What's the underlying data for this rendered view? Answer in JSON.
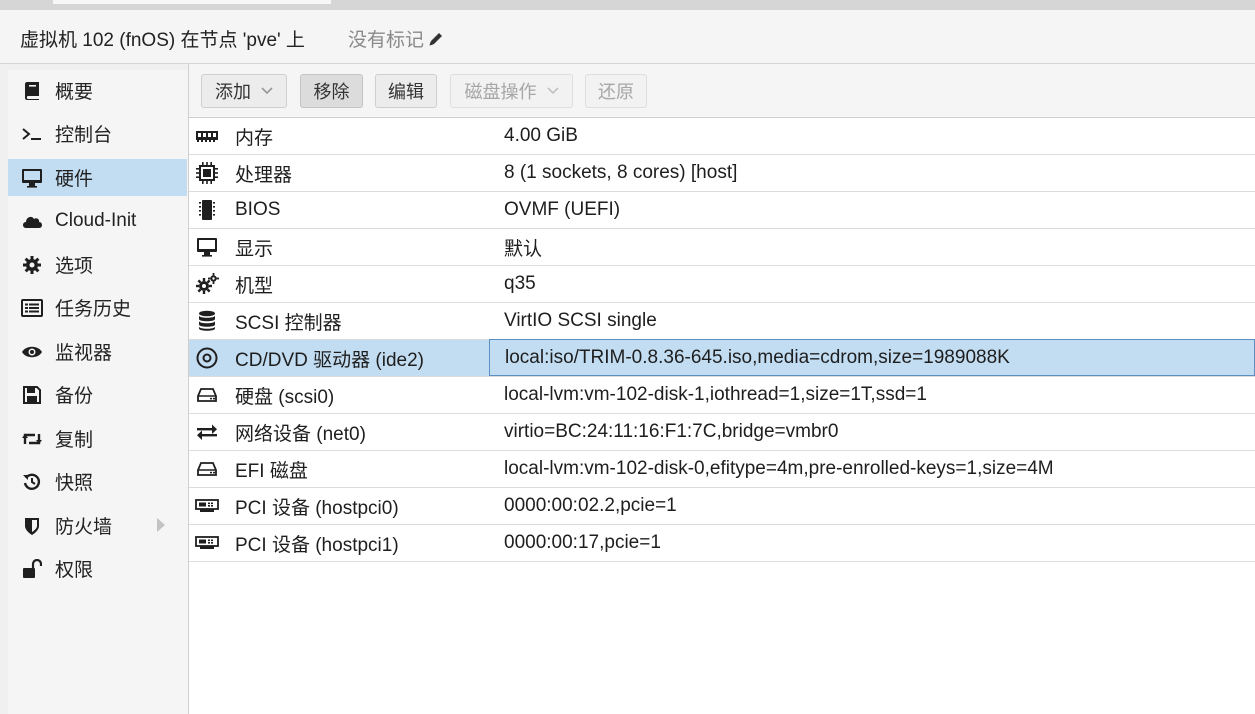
{
  "header": {
    "title": "虚拟机 102 (fnOS) 在节点 'pve' 上",
    "tags_label": "没有标记"
  },
  "sidebar": {
    "items": [
      {
        "label": "概要",
        "icon": "book-icon"
      },
      {
        "label": "控制台",
        "icon": "terminal-icon"
      },
      {
        "label": "硬件",
        "icon": "desktop-icon",
        "selected": true
      },
      {
        "label": "Cloud-Init",
        "icon": "cloud-icon"
      },
      {
        "label": "选项",
        "icon": "gear-icon"
      },
      {
        "label": "任务历史",
        "icon": "list-icon"
      },
      {
        "label": "监视器",
        "icon": "eye-icon"
      },
      {
        "label": "备份",
        "icon": "floppy-icon"
      },
      {
        "label": "复制",
        "icon": "retweet-icon"
      },
      {
        "label": "快照",
        "icon": "history-icon"
      },
      {
        "label": "防火墙",
        "icon": "shield-icon",
        "expandable": true
      },
      {
        "label": "权限",
        "icon": "unlock-icon"
      }
    ]
  },
  "toolbar": {
    "add": "添加",
    "remove": "移除",
    "edit": "编辑",
    "disk_action": "磁盘操作",
    "revert": "还原"
  },
  "hardware": [
    {
      "name": "内存",
      "value": "4.00 GiB",
      "icon": "memory-icon"
    },
    {
      "name": "处理器",
      "value": "8 (1 sockets, 8 cores) [host]",
      "icon": "cpu-icon"
    },
    {
      "name": "BIOS",
      "value": "OVMF (UEFI)",
      "icon": "microchip-icon"
    },
    {
      "name": "显示",
      "value": "默认",
      "icon": "desktop-icon"
    },
    {
      "name": "机型",
      "value": "q35",
      "icon": "cogs-icon"
    },
    {
      "name": "SCSI 控制器",
      "value": "VirtIO SCSI single",
      "icon": "database-icon"
    },
    {
      "name": "CD/DVD 驱动器 (ide2)",
      "value": "local:iso/TRIM-0.8.36-645.iso,media=cdrom,size=1989088K",
      "icon": "cdrom-icon",
      "selected": true
    },
    {
      "name": "硬盘 (scsi0)",
      "value": "local-lvm:vm-102-disk-1,iothread=1,size=1T,ssd=1",
      "icon": "hdd-icon"
    },
    {
      "name": "网络设备 (net0)",
      "value": "virtio=BC:24:11:16:F1:7C,bridge=vmbr0",
      "icon": "exchange-icon"
    },
    {
      "name": "EFI 磁盘",
      "value": "local-lvm:vm-102-disk-0,efitype=4m,pre-enrolled-keys=1,size=4M",
      "icon": "hdd-icon"
    },
    {
      "name": "PCI 设备 (hostpci0)",
      "value": "0000:00:02.2,pcie=1",
      "icon": "pci-card-icon"
    },
    {
      "name": "PCI 设备 (hostpci1)",
      "value": "0000:00:17,pcie=1",
      "icon": "pci-card-icon"
    }
  ]
}
